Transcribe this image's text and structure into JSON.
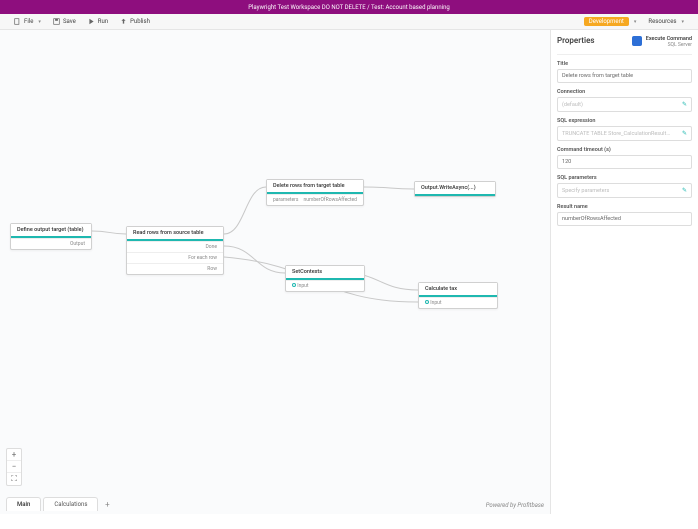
{
  "topbar": {
    "title": "Playwright Test Workspace DO NOT DELETE / Test: Account based planning"
  },
  "toolbar": {
    "file": "File",
    "save": "Save",
    "run": "Run",
    "publish": "Publish",
    "development": "Development",
    "resources": "Resources"
  },
  "nodes": {
    "n1": {
      "title": "Define output target (table)",
      "out": "Output"
    },
    "n2": {
      "title": "Read rows from source table",
      "r1": "Done",
      "r2": "For each row",
      "r3": "Row"
    },
    "n3": {
      "title": "Delete rows from target table",
      "r1l": "parameters",
      "r1r": "numberOfRowsAffected"
    },
    "n4": {
      "title": "Output.WriteAsync(...)"
    },
    "n5": {
      "title": "SetContexts",
      "r1": "Input"
    },
    "n6": {
      "title": "Calculate tax",
      "r1": "Input"
    }
  },
  "zoom": {
    "in": "+",
    "out": "−",
    "fit": "⛶"
  },
  "tabs": {
    "t1": "Main",
    "t2": "Calculations",
    "add": "+"
  },
  "powered": "Powered by Profitbase",
  "props": {
    "header": "Properties",
    "type1": "Execute Command",
    "type2": "SQL Server",
    "title_lbl": "Title",
    "title_val": "Delete rows from target table",
    "conn_lbl": "Connection",
    "conn_val": "(default)",
    "sql_lbl": "SQL expression",
    "sql_val": "TRUNCATE TABLE Store_CalculationResult_Test1_015...",
    "timeout_lbl": "Command timeout (s)",
    "timeout_val": "120",
    "params_lbl": "SQL parameters",
    "params_val": "Specify parameters",
    "result_lbl": "Result name",
    "result_val": "numberOfRowsAffected"
  }
}
